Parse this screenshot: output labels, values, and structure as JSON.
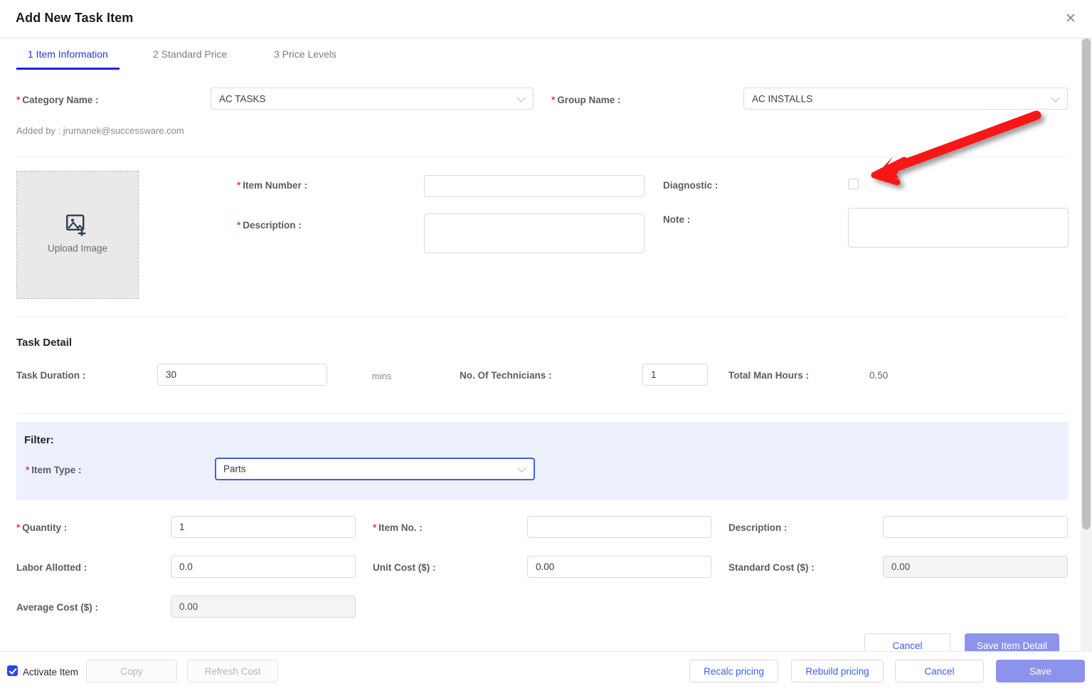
{
  "header": {
    "title": "Add New Task Item",
    "close_label": "✕"
  },
  "tabs": [
    {
      "label": "1 Item Information",
      "active": true
    },
    {
      "label": "2 Standard Price",
      "active": false
    },
    {
      "label": "3 Price Levels",
      "active": false
    }
  ],
  "top_form": {
    "category_label": "Category Name :",
    "category_value": "AC TASKS",
    "group_label": "Group Name :",
    "group_value": "AC INSTALLS",
    "added_by": "Added by : jrumanek@successware.com"
  },
  "item_block": {
    "upload_text": "Upload Image",
    "item_number_label": "Item Number :",
    "item_number_value": "",
    "description_label": "Description :",
    "description_value": "",
    "diagnostic_label": "Diagnostic :",
    "diagnostic_checked": false,
    "note_label": "Note :",
    "note_value": ""
  },
  "task_detail": {
    "section_title": "Task Detail",
    "duration_label": "Task Duration :",
    "duration_value": "30",
    "mins_unit": "mins",
    "techs_label": "No. Of Technicians :",
    "techs_value": "1",
    "man_hours_label": "Total Man Hours :",
    "man_hours_value": "0.50"
  },
  "filter": {
    "title": "Filter:",
    "item_type_label": "Item Type :",
    "item_type_value": "Parts"
  },
  "detail_form": {
    "quantity_label": "Quantity :",
    "quantity_value": "1",
    "item_no_label": "Item No. :",
    "item_no_value": "",
    "description_label": "Description :",
    "description_value": "",
    "labor_allotted_label": "Labor Allotted :",
    "labor_allotted_value": "0.0",
    "unit_cost_label": "Unit Cost ($) :",
    "unit_cost_value": "0.00",
    "standard_cost_label": "Standard Cost ($) :",
    "standard_cost_value": "0.00",
    "average_cost_label": "Average Cost ($) :",
    "average_cost_value": "0.00"
  },
  "inner_actions": {
    "cancel_label": "Cancel",
    "save_item_detail_label": "Save Item Detail"
  },
  "footer": {
    "activate_label": "Activate Item",
    "activate_checked": true,
    "copy_label": "Copy",
    "refresh_cost_label": "Refresh Cost",
    "recalc_pricing_label": "Recalc pricing",
    "rebuild_pricing_label": "Rebuild pricing",
    "cancel_label": "Cancel",
    "save_label": "Save"
  },
  "annotation": {
    "type": "arrow",
    "color": "#f81414",
    "points_at": "diagnostic-checkbox"
  },
  "colors": {
    "accent_blue": "#2b33e8",
    "link_blue": "#3b5cf0",
    "primary_button": "#8b93ed",
    "required_red": "#e8384f",
    "filter_panel": "#edf0fd",
    "arrow_red": "#f81414"
  }
}
